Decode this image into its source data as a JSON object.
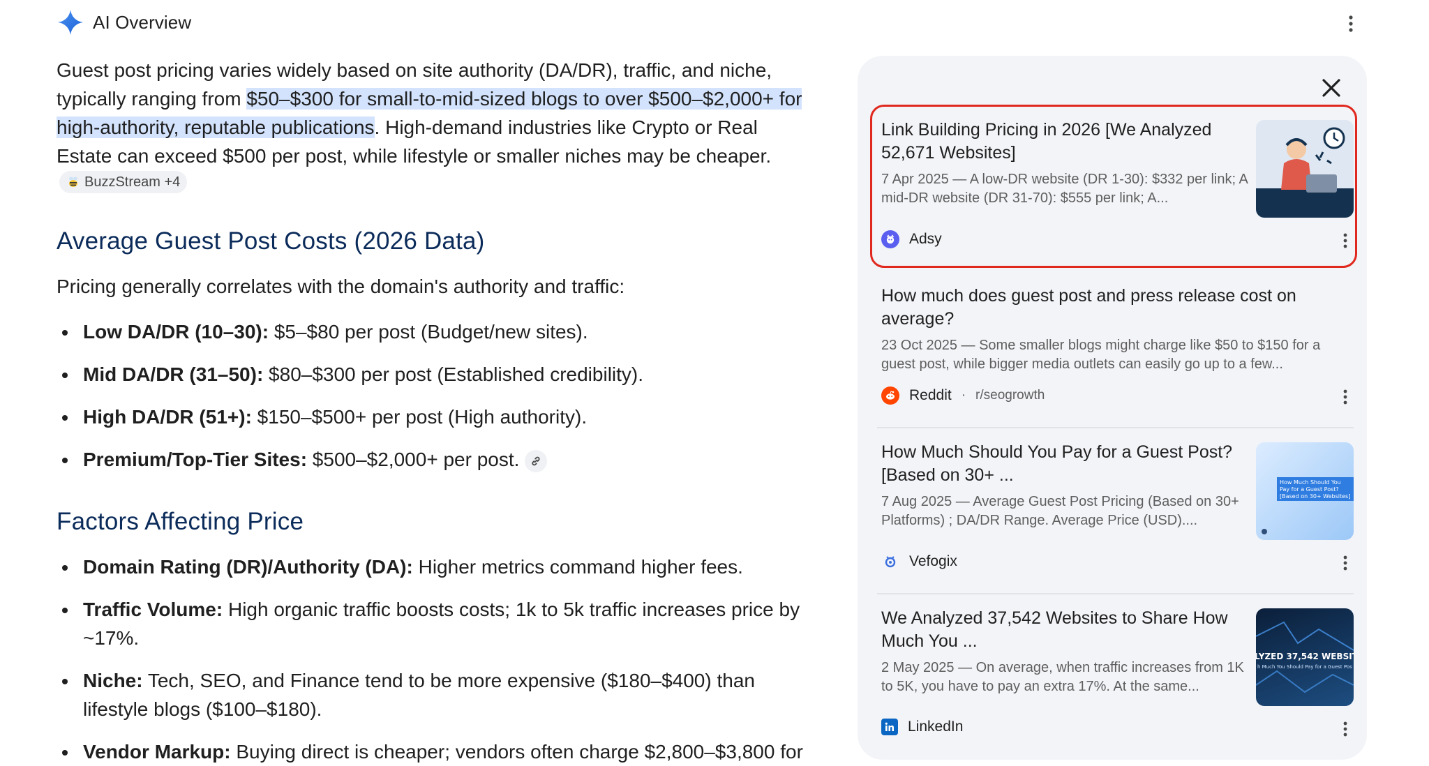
{
  "header": {
    "title": "AI Overview",
    "spark_icon": "gemini-spark-icon",
    "menu_icon": "more-vert-icon"
  },
  "intro": {
    "before": "Guest post pricing varies widely based on site authority (DA/DR), traffic, and niche, typically ranging from ",
    "highlight": "$50–$300 for small-to-mid-sized blogs to over $500–$2,000+ for high-authority, reputable publications",
    "after": ". High-demand industries like Crypto or Real Estate can exceed $500 per post, while lifestyle or smaller niches may be cheaper.",
    "chip_label": "BuzzStream +4"
  },
  "section1": {
    "heading": "Average Guest Post Costs (2026 Data)",
    "lead": "Pricing generally correlates with the domain's authority and traffic:",
    "items": [
      {
        "label": "Low DA/DR (10–30):",
        "text": " $5–$80 per post (Budget/new sites)."
      },
      {
        "label": "Mid DA/DR (31–50):",
        "text": " $80–$300 per post (Established credibility)."
      },
      {
        "label": "High DA/DR (51+):",
        "text": " $150–$500+ per post (High authority)."
      },
      {
        "label": "Premium/Top-Tier Sites:",
        "text": " $500–$2,000+ per post."
      }
    ]
  },
  "section2": {
    "heading": "Factors Affecting Price",
    "items": [
      {
        "label": "Domain Rating (DR)/Authority (DA):",
        "text": " Higher metrics command higher fees."
      },
      {
        "label": "Traffic Volume:",
        "text": " High organic traffic boosts costs; 1k to 5k traffic increases price by ~17%."
      },
      {
        "label": "Niche:",
        "text": " Tech, SEO, and Finance tend to be more expensive ($180–$400) than lifestyle blogs ($100–$180)."
      },
      {
        "label": "Vendor Markup:",
        "text": " Buying direct is cheaper; vendors often charge $2,800–$3,800 for"
      }
    ]
  },
  "sources": [
    {
      "title": "Link Building Pricing in 2026 [We Analyzed 52,671 Websites]",
      "snippet": "7 Apr 2025 — A low-DR website (DR 1-30): $332 per link; A mid-DR website (DR 31-70): $555 per link; A...",
      "site": "Adsy",
      "sub": "",
      "selected": true
    },
    {
      "title": "How much does guest post and press release cost on average?",
      "snippet": "23 Oct 2025 — Some smaller blogs might charge like $50 to $150 for a guest post, while bigger media outlets can easily go up to a few...",
      "site": "Reddit",
      "sub": "r/seogrowth",
      "selected": false
    },
    {
      "title": "How Much Should You Pay for a Guest Post? [Based on 30+ ...",
      "snippet": "7 Aug 2025 — Average Guest Post Pricing (Based on 30+ Platforms) ; DA/DR Range. Average Price (USD)....",
      "site": "Vefogix",
      "sub": "",
      "thumb_text": "How Much Should You Pay for a Guest Post? [Based on 30+ Websites]",
      "selected": false
    },
    {
      "title": "We Analyzed 37,542 Websites to Share How Much You ...",
      "snippet": "2 May 2025 — On average, when traffic increases from 1K to 5K, you have to pay an extra 17%. At the same...",
      "site": "LinkedIn",
      "sub": "",
      "thumb_text": "LYZED 37,542 WEBSITE",
      "thumb_sub": "h Much You Should Pay for a Guest Pos",
      "selected": false
    }
  ],
  "colors": {
    "highlight": "#d3e3fd",
    "heading": "#0b2b5a",
    "panel": "#f3f4f8",
    "selection": "#e0281e"
  }
}
